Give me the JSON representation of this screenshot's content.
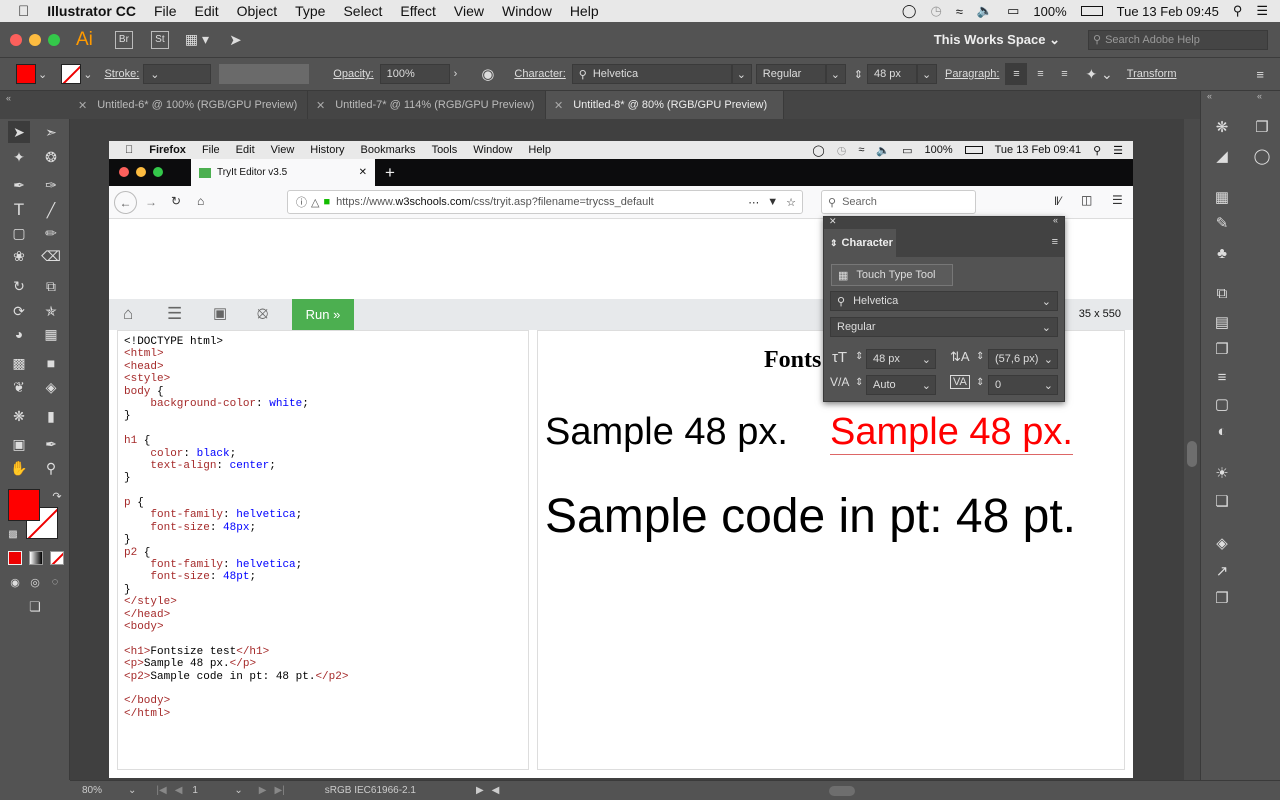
{
  "os_menubar": {
    "app": "Illustrator CC",
    "items": [
      "File",
      "Edit",
      "Object",
      "Type",
      "Select",
      "Effect",
      "View",
      "Window",
      "Help"
    ],
    "battery": "100%",
    "datetime": "Tue 13 Feb  09:45"
  },
  "app_bar": {
    "app_logo": "Ai",
    "bridge": "Br",
    "stock": "St",
    "workspace": "This Works Space",
    "search_placeholder": "Search Adobe Help"
  },
  "control_bar": {
    "stroke_label": "Stroke:",
    "opacity_label": "Opacity:",
    "opacity_value": "100%",
    "character_label": "Character:",
    "font": "Helvetica",
    "style": "Regular",
    "size": "48 px",
    "paragraph_label": "Paragraph:",
    "transform_label": "Transform",
    "fill_color": "#ff0000"
  },
  "doc_tabs": [
    {
      "label": "Untitled-6* @ 100% (RGB/GPU Preview)",
      "active": false
    },
    {
      "label": "Untitled-7* @ 114% (RGB/GPU Preview)",
      "active": false
    },
    {
      "label": "Untitled-8* @ 80% (RGB/GPU Preview)",
      "active": true
    }
  ],
  "status_bar": {
    "zoom": "80%",
    "page": "1",
    "profile": "sRGB IEC61966-2.1"
  },
  "firefox": {
    "menu": {
      "app": "Firefox",
      "items": [
        "File",
        "Edit",
        "View",
        "History",
        "Bookmarks",
        "Tools",
        "Window",
        "Help"
      ],
      "battery": "100%",
      "datetime": "Tue 13 Feb  09:41"
    },
    "tab_title": "TryIt Editor v3.5",
    "url_prefix": "https://www.",
    "url_domain": "w3schools.com",
    "url_path": "/css/tryit.asp?filename=trycss_default",
    "search_placeholder": "Search"
  },
  "tryit": {
    "run_label": "Run »",
    "size_readout": "35 x 550",
    "result_heading": "Fonts",
    "sample_px": "Sample 48 px.",
    "sample_px_outlined": "Sample 48 px.",
    "sample_pt": "Sample code in pt: 48 pt."
  },
  "code_lines": [
    [
      [
        "t",
        "<!DOCTYPE html>"
      ]
    ],
    [
      [
        "g",
        "<html>"
      ]
    ],
    [
      [
        "g",
        "<head>"
      ]
    ],
    [
      [
        "g",
        "<style>"
      ]
    ],
    [
      [
        "k",
        "body"
      ],
      [
        "t",
        " {"
      ]
    ],
    [
      [
        "t",
        "    "
      ],
      [
        "k",
        "background-color"
      ],
      [
        "t",
        ": "
      ],
      [
        "v",
        "white"
      ],
      [
        "t",
        ";"
      ]
    ],
    [
      [
        "t",
        "}"
      ]
    ],
    [
      [
        "t",
        ""
      ]
    ],
    [
      [
        "k",
        "h1"
      ],
      [
        "t",
        " {"
      ]
    ],
    [
      [
        "t",
        "    "
      ],
      [
        "k",
        "color"
      ],
      [
        "t",
        ": "
      ],
      [
        "v",
        "black"
      ],
      [
        "t",
        ";"
      ]
    ],
    [
      [
        "t",
        "    "
      ],
      [
        "k",
        "text-align"
      ],
      [
        "t",
        ": "
      ],
      [
        "v",
        "center"
      ],
      [
        "t",
        ";"
      ]
    ],
    [
      [
        "t",
        "}"
      ]
    ],
    [
      [
        "t",
        ""
      ]
    ],
    [
      [
        "k",
        "p"
      ],
      [
        "t",
        " {"
      ]
    ],
    [
      [
        "t",
        "    "
      ],
      [
        "k",
        "font-family"
      ],
      [
        "t",
        ": "
      ],
      [
        "v",
        "helvetica"
      ],
      [
        "t",
        ";"
      ]
    ],
    [
      [
        "t",
        "    "
      ],
      [
        "k",
        "font-size"
      ],
      [
        "t",
        ": "
      ],
      [
        "v",
        "48px"
      ],
      [
        "t",
        ";"
      ]
    ],
    [
      [
        "t",
        "}"
      ]
    ],
    [
      [
        "k",
        "p2"
      ],
      [
        "t",
        " {"
      ]
    ],
    [
      [
        "t",
        "    "
      ],
      [
        "k",
        "font-family"
      ],
      [
        "t",
        ": "
      ],
      [
        "v",
        "helvetica"
      ],
      [
        "t",
        ";"
      ]
    ],
    [
      [
        "t",
        "    "
      ],
      [
        "k",
        "font-size"
      ],
      [
        "t",
        ": "
      ],
      [
        "v",
        "48pt"
      ],
      [
        "t",
        ";"
      ]
    ],
    [
      [
        "t",
        "}"
      ]
    ],
    [
      [
        "g",
        "</style>"
      ]
    ],
    [
      [
        "g",
        "</head>"
      ]
    ],
    [
      [
        "g",
        "<body>"
      ]
    ],
    [
      [
        "t",
        ""
      ]
    ],
    [
      [
        "g",
        "<h1>"
      ],
      [
        "t",
        "Fontsize test"
      ],
      [
        "g",
        "</h1>"
      ]
    ],
    [
      [
        "g",
        "<p>"
      ],
      [
        "t",
        "Sample 48 px."
      ],
      [
        "g",
        "</p>"
      ]
    ],
    [
      [
        "g",
        "<p2>"
      ],
      [
        "t",
        "Sample code in pt: 48 pt."
      ],
      [
        "g",
        "</p2>"
      ]
    ],
    [
      [
        "t",
        ""
      ]
    ],
    [
      [
        "g",
        "</body>"
      ]
    ],
    [
      [
        "g",
        "</html>"
      ]
    ]
  ],
  "character_panel": {
    "title": "Character",
    "touch_type": "Touch Type Tool",
    "font": "Helvetica",
    "style": "Regular",
    "size": "48 px",
    "leading": "(57,6 px)",
    "kerning": "Auto",
    "tracking": "0"
  }
}
